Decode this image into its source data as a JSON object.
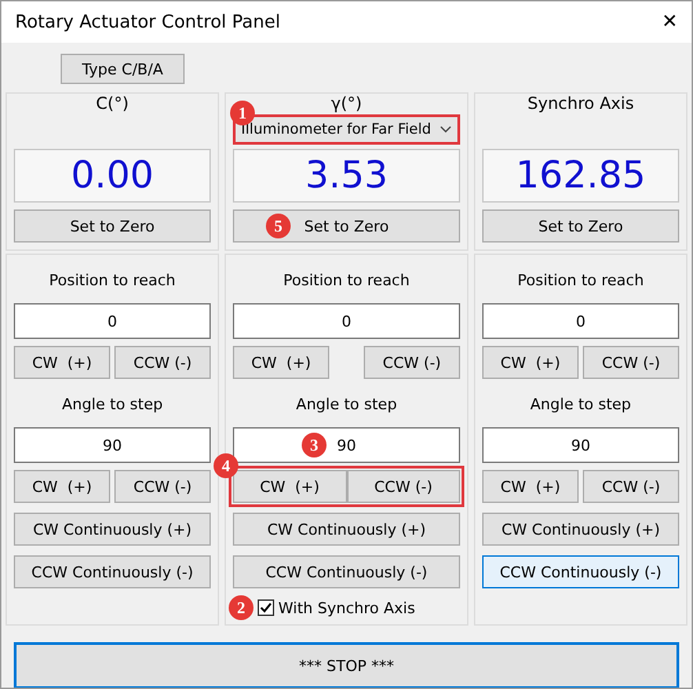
{
  "window": {
    "title": "Rotary Actuator Control Panel",
    "close": "✕"
  },
  "type_button": "Type C/B/A",
  "columns": [
    {
      "header": "C(°)",
      "reading": "0.00",
      "zero_button": {
        "label": "Set to Zero"
      },
      "position_label": "Position to reach",
      "position_value": "0",
      "position_buttons": [
        "CW  (+)",
        "CCW (-)"
      ],
      "angle_label": "Angle to step",
      "angle_value": "90",
      "step_buttons": {
        "labels": [
          "CW  (+)",
          "CCW (-)"
        ],
        "highlighted": false
      },
      "continuous_buttons": [
        {
          "label": "CW Continuously (+)",
          "focused": false
        },
        {
          "label": "CCW Continuously (-)",
          "focused": false
        }
      ]
    },
    {
      "header": "γ(°)",
      "selector": {
        "value": "Illuminometer for Far Field",
        "highlighted": true,
        "callout": "1"
      },
      "reading": "3.53",
      "zero_button": {
        "label": "Set to Zero",
        "callout": "5"
      },
      "position_label": "Position to reach",
      "position_value": "0",
      "position_buttons": [
        "CW  (+)",
        "CCW (-)"
      ],
      "angle_label": "Angle to step",
      "angle_value": "90",
      "angle_callout": "3",
      "step_buttons": {
        "labels": [
          "CW  (+)",
          "CCW (-)"
        ],
        "highlighted": true,
        "callout": "4"
      },
      "continuous_buttons": [
        {
          "label": "CW Continuously (+)",
          "focused": false
        },
        {
          "label": "CCW Continuously (-)",
          "focused": false
        }
      ],
      "checkbox": {
        "label": "With Synchro Axis",
        "checked": true,
        "callout": "2"
      }
    },
    {
      "header": "Synchro Axis",
      "reading": "162.85",
      "zero_button": {
        "label": "Set to Zero"
      },
      "position_label": "Position to reach",
      "position_value": "0",
      "position_buttons": [
        "CW  (+)",
        "CCW (-)"
      ],
      "angle_label": "Angle to step",
      "angle_value": "90",
      "step_buttons": {
        "labels": [
          "CW  (+)",
          "CCW (-)"
        ],
        "highlighted": false
      },
      "continuous_buttons": [
        {
          "label": "CW Continuously (+)",
          "focused": false
        },
        {
          "label": "CCW Continuously (-)",
          "focused": true
        }
      ]
    }
  ],
  "stop_button": "*** STOP ***"
}
